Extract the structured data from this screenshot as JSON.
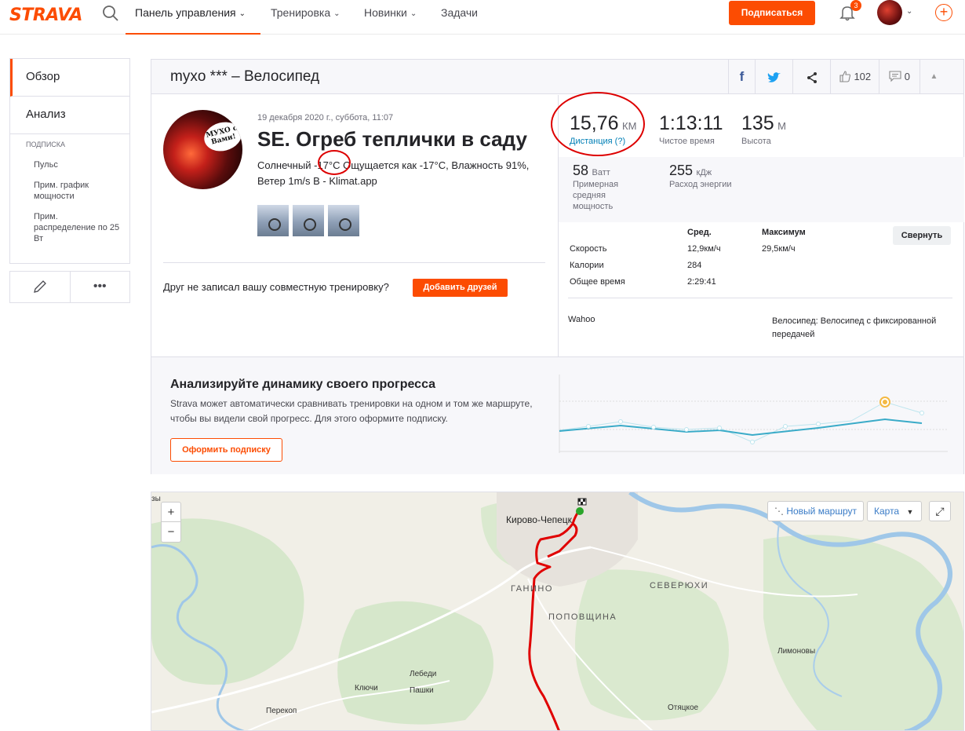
{
  "nav": {
    "logo": "STRAVA",
    "items": [
      {
        "label": "Панель управления"
      },
      {
        "label": "Тренировка"
      },
      {
        "label": "Новинки"
      },
      {
        "label": "Задачи"
      }
    ],
    "subscribe_label": "Подписаться",
    "notifications_count": "3"
  },
  "sidebar": {
    "overview": "Обзор",
    "analysis": "Анализ",
    "sub_title": "ПОДПИСКА",
    "sub_items": [
      "Пульс",
      "Прим. график мощности",
      "Прим. распределение по 25 Вт"
    ],
    "edit_icon": "pencil-icon",
    "more_icon": "more-icon"
  },
  "activity": {
    "header_title": "myxo *** – Велосипед",
    "kudos": "102",
    "comments": "0",
    "date": "19 декабря 2020 г., суббота, 11:07",
    "name": "SE. Огреб теплички в саду",
    "desc_before": "Солнечный ",
    "desc_temp": "-17°C",
    "desc_after": " Ощущается как -17°C, Влажность 91%, Ветер 1m/s В - Klimat.app",
    "avatar_text": "МУХО с Вами!",
    "friend_question": "Друг не записал вашу совместную тренировку?",
    "add_friends": "Добавить друзей"
  },
  "stats": {
    "distance": {
      "value": "15,76",
      "unit": "КМ",
      "label": "Дистанция (?)"
    },
    "moving_time": {
      "value": "1:13:11",
      "label": "Чистое время"
    },
    "elevation": {
      "value": "135",
      "unit": "М",
      "label": "Высота"
    },
    "power": {
      "value": "58",
      "unit": "Ватт",
      "label": "Примерная средняя мощность"
    },
    "energy": {
      "value": "255",
      "unit": "кДж",
      "label": "Расход энергии"
    },
    "table": {
      "col_avg": "Сред.",
      "col_max": "Максимум",
      "flip": "Свернуть",
      "rows": [
        {
          "label": "Скорость",
          "avg": "12,9км/ч",
          "max": "29,5км/ч"
        },
        {
          "label": "Калории",
          "avg": "284",
          "max": ""
        },
        {
          "label": "Общее время",
          "avg": "2:29:41",
          "max": ""
        }
      ]
    },
    "device": "Wahoo",
    "bike": "Велосипед: Велосипед с фиксированной передачей"
  },
  "upsell": {
    "title": "Анализируйте динамику своего прогресса",
    "text": "Strava может автоматически сравнивать тренировки на одном и том же маршруте, чтобы вы видели свой прогресс. Для этого оформите подписку.",
    "button": "Оформить подписку"
  },
  "map": {
    "zoom_in": "+",
    "zoom_out": "−",
    "new_route": "Новый маршрут",
    "layer": "Карта",
    "places": {
      "kirovo": "Кирово-Чепецк",
      "ganino": "ГАНИНО",
      "severyuhi": "СЕВЕРЮХИ",
      "popovshchina": "ПОПОВЩИНА",
      "limonovy": "Лимоновы",
      "lebedi": "Лебеди",
      "pashki": "Пашки",
      "klyuchi": "Ключи",
      "perekop": "Перекоп",
      "otyatskoe": "Отяцкое",
      "edge": "зы"
    }
  },
  "colors": {
    "brand": "#fc4c02",
    "route": "#e00000",
    "link": "#007fb6"
  }
}
